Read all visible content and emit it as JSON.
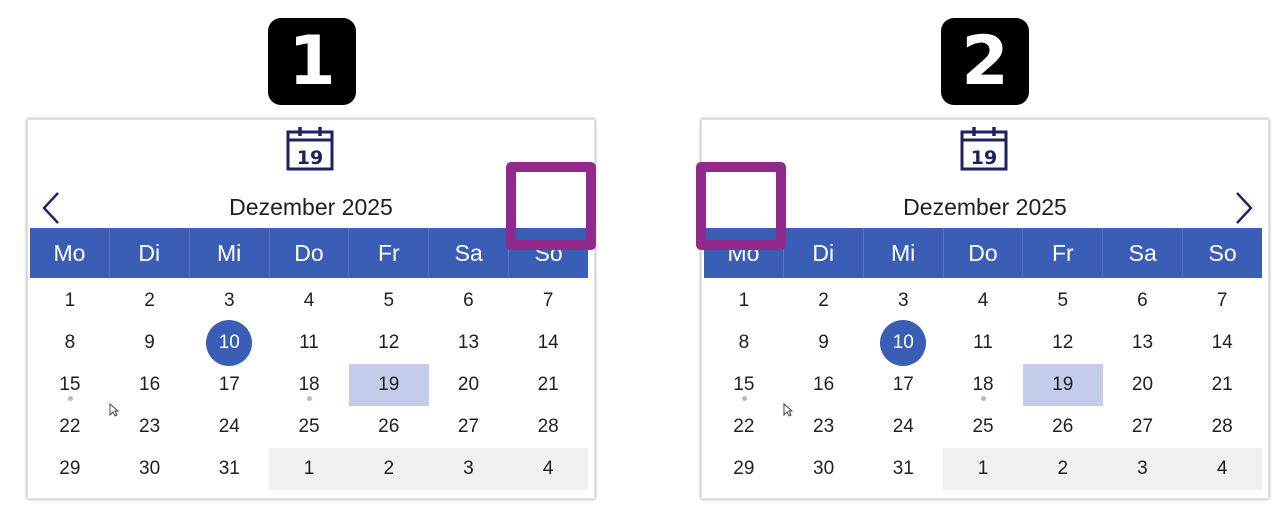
{
  "panels": [
    {
      "badge": "1",
      "month_title": "Dezember 2025",
      "icon_day": "19",
      "nav_arrows": [
        "prev-arrow"
      ],
      "highlight": "next-month-button-area"
    },
    {
      "badge": "2",
      "month_title": "Dezember 2025",
      "icon_day": "19",
      "nav_arrows": [
        "next-arrow"
      ],
      "highlight": "prev-month-button-area"
    }
  ],
  "weekdays": [
    "Mo",
    "Di",
    "Mi",
    "Do",
    "Fr",
    "Sa",
    "So"
  ],
  "weeks": [
    [
      "1",
      "2",
      "3",
      "4",
      "5",
      "6",
      "7"
    ],
    [
      "8",
      "9",
      "10",
      "11",
      "12",
      "13",
      "14"
    ],
    [
      "15",
      "16",
      "17",
      "18",
      "19",
      "20",
      "21"
    ],
    [
      "22",
      "23",
      "24",
      "25",
      "26",
      "27",
      "28"
    ],
    [
      "29",
      "30",
      "31",
      "1",
      "2",
      "3",
      "4"
    ]
  ],
  "today_day": "10",
  "selected_day": "19",
  "days_with_events": [
    "15",
    "18"
  ],
  "next_month_days_in_last_week": [
    "1",
    "2",
    "3",
    "4"
  ],
  "colors": {
    "header_blue": "#3a5db6",
    "selected_day_bg": "#c3cce8",
    "next_month_bg": "#f0f0f0",
    "highlight_frame": "#912a8c",
    "icon_navy": "#1b2461"
  },
  "icons": [
    "calendar-icon",
    "chevron-left-icon",
    "chevron-right-icon",
    "event-dot-icon",
    "mouse-cursor-icon"
  ]
}
